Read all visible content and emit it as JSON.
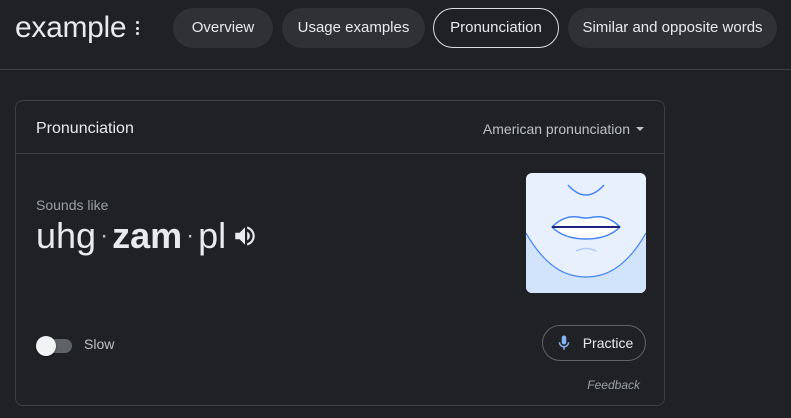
{
  "header": {
    "word": "example",
    "more_icon": "more-vert-icon",
    "tabs": [
      {
        "label": "Overview",
        "active": false
      },
      {
        "label": "Usage examples",
        "active": false
      },
      {
        "label": "Pronunciation",
        "active": true
      },
      {
        "label": "Similar and opposite words",
        "active": false
      }
    ]
  },
  "card": {
    "title": "Pronunciation",
    "accent": "American pronunciation",
    "sounds_like_label": "Sounds like",
    "syllables": [
      {
        "text": "uhg",
        "stressed": false
      },
      {
        "text": "zam",
        "stressed": true
      },
      {
        "text": "pl",
        "stressed": false
      }
    ],
    "separator": "·",
    "speaker_icon": "volume-up-icon",
    "mouth_image": "mouth-diagram",
    "slow_label": "Slow",
    "slow_enabled": false,
    "practice_label": "Practice",
    "practice_icon": "mic-icon",
    "feedback_label": "Feedback"
  },
  "colors": {
    "background": "#202124",
    "chip": "#303134",
    "border": "#3c4043",
    "mic_blue": "#8ab4f8",
    "mouth_bg": "#e8f0fe",
    "mouth_lines": "#4285f4"
  }
}
